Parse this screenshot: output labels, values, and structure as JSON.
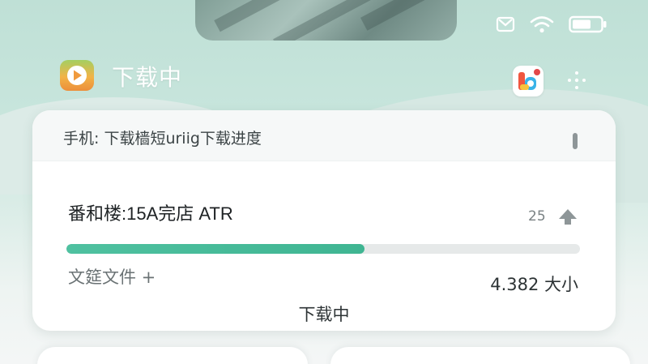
{
  "app": {
    "title": "下载中",
    "icon": "play-app-icon",
    "secondary_icon": "color-app-icon"
  },
  "status_bar": {
    "icons": [
      "mail-icon",
      "wifi-icon",
      "battery-icon"
    ]
  },
  "card": {
    "title": "手机: 下载樯短uriig下载进度",
    "file_name": "番和楼:15A完店 ATR",
    "count": "25",
    "progress_fraction": 0.58,
    "file_type": "文筵文件 +",
    "size": "4.382 大小",
    "footer_status": "下载中"
  },
  "colors": {
    "accent": "#3fb592",
    "background": "#c7e5dc",
    "card": "#ffffff"
  }
}
